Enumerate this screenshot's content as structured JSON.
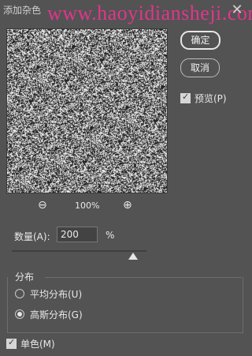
{
  "window": {
    "title": "添加杂色",
    "watermark": "www.haoyidiansheji.com"
  },
  "buttons": {
    "ok_label": "确定",
    "cancel_label": "取消"
  },
  "preview": {
    "label": "预览(P)",
    "checked": true
  },
  "zoom": {
    "level": "100%"
  },
  "amount": {
    "label": "数量(A):",
    "value": "200",
    "unit": "%",
    "slider_fraction": 0.9
  },
  "distribution": {
    "title": "分布",
    "options": [
      {
        "label": "平均分布(U)",
        "selected": false
      },
      {
        "label": "高斯分布(G)",
        "selected": true
      }
    ]
  },
  "monochromatic": {
    "label": "单色(M)",
    "checked": true
  },
  "icons": {
    "close": "close-icon",
    "zoom_out": "zoom-out-icon",
    "zoom_in": "zoom-in-icon",
    "check": "checkmark-icon"
  }
}
